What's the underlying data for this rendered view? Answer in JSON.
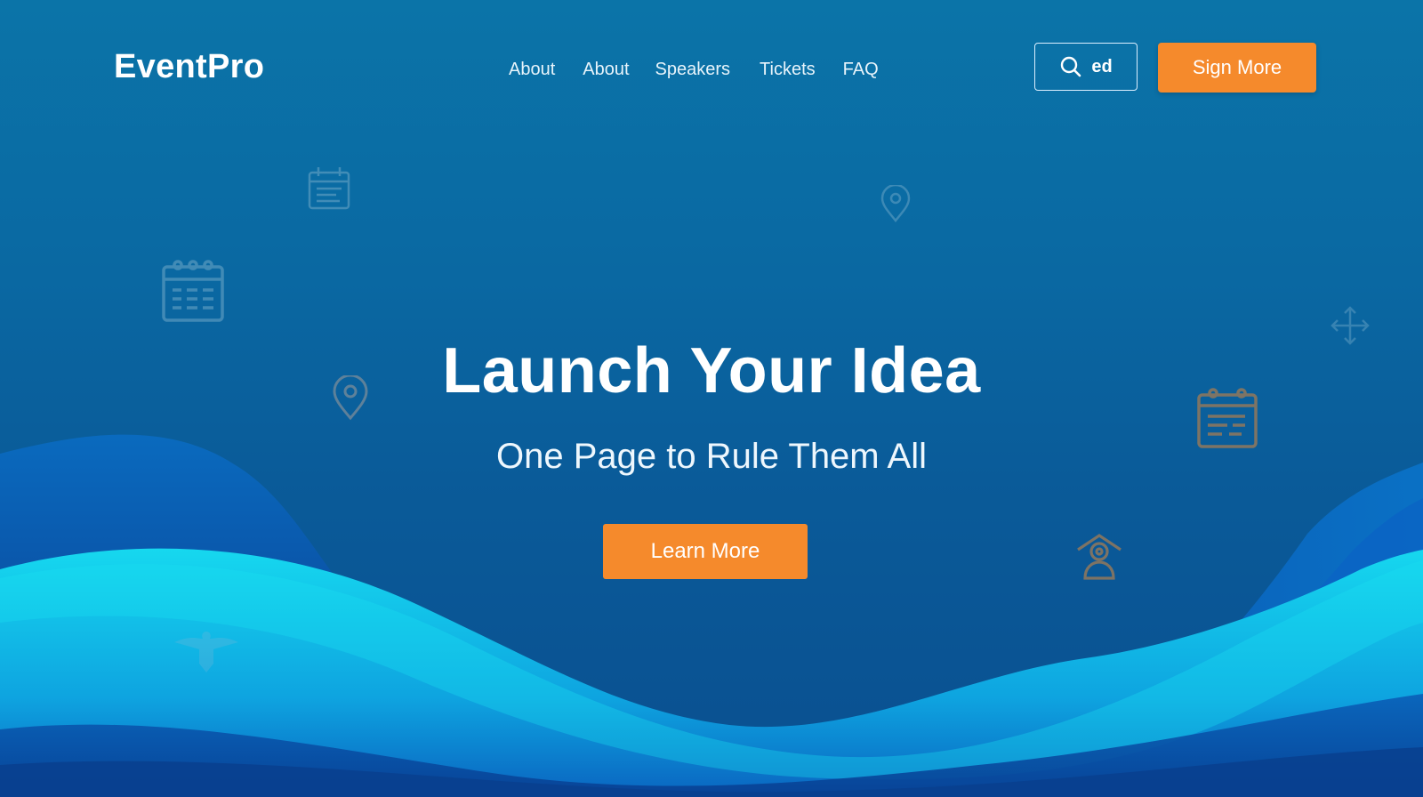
{
  "brand": {
    "name": "EventPro"
  },
  "nav": {
    "items": [
      {
        "label": "About"
      },
      {
        "label": "About"
      },
      {
        "label": "Speakers"
      },
      {
        "label": "Tickets"
      },
      {
        "label": "FAQ"
      }
    ]
  },
  "header": {
    "search": {
      "label": "ed",
      "icon": "search-icon"
    },
    "signin_label": "Sign More"
  },
  "hero": {
    "title": "Launch Your Idea",
    "subtitle": "One Page to Rule Them All",
    "cta_label": "Learn More"
  },
  "decorations": [
    {
      "icon": "calendar-icon"
    },
    {
      "icon": "calendar-icon"
    },
    {
      "icon": "location-pin-icon"
    },
    {
      "icon": "location-pin-icon"
    },
    {
      "icon": "calendar-icon"
    },
    {
      "icon": "speaker-icon"
    },
    {
      "icon": "move-arrows-icon"
    },
    {
      "icon": "bird-icon"
    }
  ],
  "colors": {
    "accent": "#f58a2c",
    "background_top": "#0b74a8",
    "background_bottom": "#0a4f90",
    "wave_light": "#13d6ee",
    "wave_dark": "#0a56b0"
  }
}
